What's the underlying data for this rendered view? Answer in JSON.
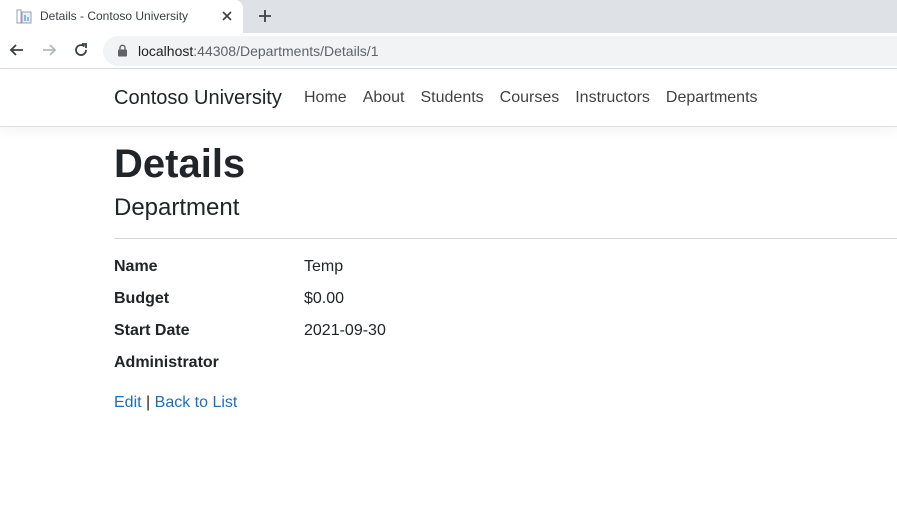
{
  "browser": {
    "tab_title": "Details - Contoso University",
    "url_host": "localhost",
    "url_rest": ":44308/Departments/Details/1"
  },
  "site": {
    "brand": "Contoso University",
    "nav": [
      "Home",
      "About",
      "Students",
      "Courses",
      "Instructors",
      "Departments"
    ]
  },
  "page": {
    "title": "Details",
    "subtitle": "Department",
    "fields": [
      {
        "label": "Name",
        "value": "Temp"
      },
      {
        "label": "Budget",
        "value": "$0.00"
      },
      {
        "label": "Start Date",
        "value": "2021-09-30"
      },
      {
        "label": "Administrator",
        "value": ""
      }
    ],
    "edit_link": "Edit",
    "separator": "|",
    "back_link": "Back to List"
  }
}
